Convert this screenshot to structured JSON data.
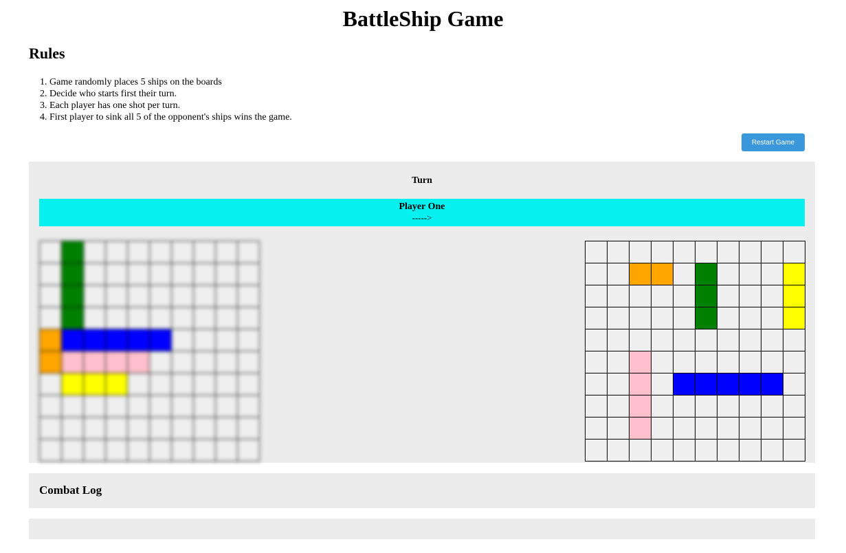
{
  "title": "BattleShip Game",
  "rules": {
    "heading": "Rules",
    "items": [
      "Game randomly places 5 ships on the boards",
      "Decide who starts first their turn.",
      "Each player has one shot per turn.",
      "First player to sink all 5 of the opponent's ships wins the game."
    ]
  },
  "restart_label": "Restart Game",
  "turn": {
    "label": "Turn",
    "player": "Player One",
    "arrow": "----->"
  },
  "combat_log": {
    "heading": "Combat Log"
  },
  "colors": {
    "cell": "#efefef",
    "green": "#008000",
    "blue": "#0000ff",
    "orange": "#ffa500",
    "pink": "#ffc0cb",
    "yellow": "#ffff00",
    "banner": "#08f1f1",
    "button": "#3a97db",
    "panel": "#ececec"
  },
  "boards": {
    "left": {
      "blurred": true,
      "ships": [
        {
          "color": "green",
          "cells": [
            [
              0,
              1
            ],
            [
              1,
              1
            ],
            [
              2,
              1
            ],
            [
              3,
              1
            ]
          ]
        },
        {
          "color": "orange",
          "cells": [
            [
              4,
              0
            ],
            [
              5,
              0
            ]
          ]
        },
        {
          "color": "blue",
          "cells": [
            [
              4,
              1
            ],
            [
              4,
              2
            ],
            [
              4,
              3
            ],
            [
              4,
              4
            ],
            [
              4,
              5
            ]
          ]
        },
        {
          "color": "pink",
          "cells": [
            [
              5,
              1
            ],
            [
              5,
              2
            ],
            [
              5,
              3
            ],
            [
              5,
              4
            ]
          ]
        },
        {
          "color": "yellow",
          "cells": [
            [
              6,
              1
            ],
            [
              6,
              2
            ],
            [
              6,
              3
            ]
          ]
        }
      ]
    },
    "right": {
      "blurred": false,
      "ships": [
        {
          "color": "orange",
          "cells": [
            [
              1,
              2
            ],
            [
              1,
              3
            ]
          ]
        },
        {
          "color": "green",
          "cells": [
            [
              1,
              5
            ],
            [
              2,
              5
            ],
            [
              3,
              5
            ]
          ]
        },
        {
          "color": "yellow",
          "cells": [
            [
              1,
              9
            ],
            [
              2,
              9
            ],
            [
              3,
              9
            ]
          ]
        },
        {
          "color": "pink",
          "cells": [
            [
              5,
              2
            ],
            [
              6,
              2
            ],
            [
              7,
              2
            ],
            [
              8,
              2
            ]
          ]
        },
        {
          "color": "blue",
          "cells": [
            [
              6,
              4
            ],
            [
              6,
              5
            ],
            [
              6,
              6
            ],
            [
              6,
              7
            ],
            [
              6,
              8
            ]
          ]
        }
      ]
    }
  }
}
